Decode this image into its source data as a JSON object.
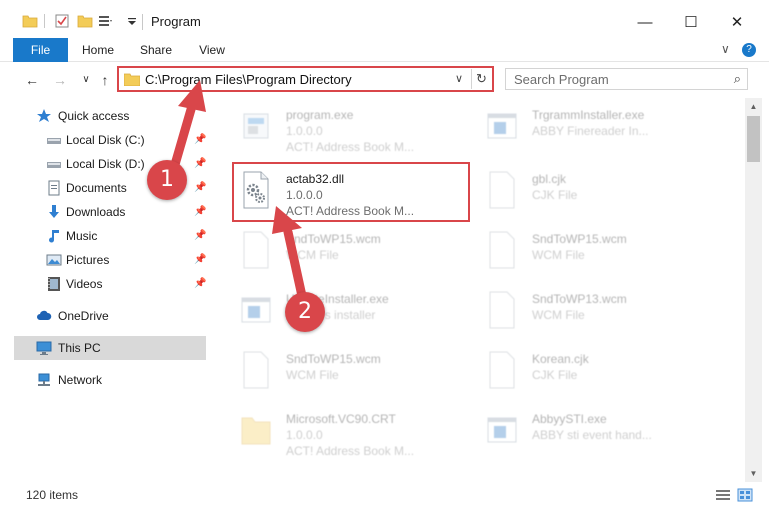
{
  "window": {
    "title": "Program",
    "minimize_glyph": "—",
    "maximize_glyph": "☐",
    "close_glyph": "✕"
  },
  "ribbon": {
    "tabs": [
      "File",
      "Home",
      "Share",
      "View"
    ],
    "expand_glyph": "∨",
    "help_glyph": "?"
  },
  "nav": {
    "back": "←",
    "forward": "→",
    "history": "∨",
    "up": "↑"
  },
  "address": {
    "path": "C:\\Program Files\\Program Directory",
    "dropdown": "∨",
    "refresh": "↻"
  },
  "search": {
    "placeholder": "Search Program",
    "icon": "⌕"
  },
  "sidebar": {
    "items": [
      {
        "label": "Quick access",
        "icon": "star-icon",
        "pinned": false
      },
      {
        "label": "Local Disk (C:)",
        "icon": "drive-icon",
        "pinned": true
      },
      {
        "label": "Local Disk (D:)",
        "icon": "drive-icon",
        "pinned": true
      },
      {
        "label": "Documents",
        "icon": "documents-icon",
        "pinned": true
      },
      {
        "label": "Downloads",
        "icon": "download-icon",
        "pinned": true
      },
      {
        "label": "Music",
        "icon": "music-icon",
        "pinned": true
      },
      {
        "label": "Pictures",
        "icon": "pictures-icon",
        "pinned": true
      },
      {
        "label": "Videos",
        "icon": "videos-icon",
        "pinned": true
      },
      {
        "label": "OneDrive",
        "icon": "cloud-icon",
        "pinned": false
      },
      {
        "label": "This PC",
        "icon": "computer-icon",
        "pinned": false,
        "selected": true
      },
      {
        "label": "Network",
        "icon": "network-icon",
        "pinned": false
      }
    ],
    "pin_glyph": "📌"
  },
  "files": [
    {
      "name": "program.exe",
      "line1": "1.0.0.0",
      "line2": "ACT! Address Book M...",
      "kind": "exe"
    },
    {
      "name": "TrgrammInstaller.exe",
      "line1": "ABBY Finereader In...",
      "line2": "",
      "kind": "app"
    },
    {
      "name": "actab32.dll",
      "line1": "1.0.0.0",
      "line2": "ACT! Address Book M...",
      "kind": "dll"
    },
    {
      "name": "gbl.cjk",
      "line1": "CJK File",
      "line2": "",
      "kind": "doc"
    },
    {
      "name": "SndToWP15.wcm",
      "line1": "WCM File",
      "line2": "",
      "kind": "doc"
    },
    {
      "name": "SndToWP15.wcm",
      "line1": "WCM File",
      "line2": "",
      "kind": "doc"
    },
    {
      "name": "UpdateInstaller.exe",
      "line1": "Updates installer",
      "line2": "",
      "kind": "app"
    },
    {
      "name": "SndToWP13.wcm",
      "line1": "WCM File",
      "line2": "",
      "kind": "doc"
    },
    {
      "name": "SndToWP15.wcm",
      "line1": "WCM File",
      "line2": "",
      "kind": "doc"
    },
    {
      "name": "Korean.cjk",
      "line1": "CJK File",
      "line2": "",
      "kind": "doc"
    },
    {
      "name": "Microsoft.VC90.CRT",
      "line1": "1.0.0.0",
      "line2": "ACT! Address Book M...",
      "kind": "folder"
    },
    {
      "name": "AbbyySTI.exe",
      "line1": "ABBY sti event hand...",
      "line2": "",
      "kind": "app"
    }
  ],
  "status": {
    "item_count": "120 items"
  },
  "callouts": [
    "1",
    "2"
  ],
  "colors": {
    "highlight_red": "#d9464a",
    "file_tab_blue": "#1979ca",
    "selection_gray": "#d9d9d9"
  }
}
